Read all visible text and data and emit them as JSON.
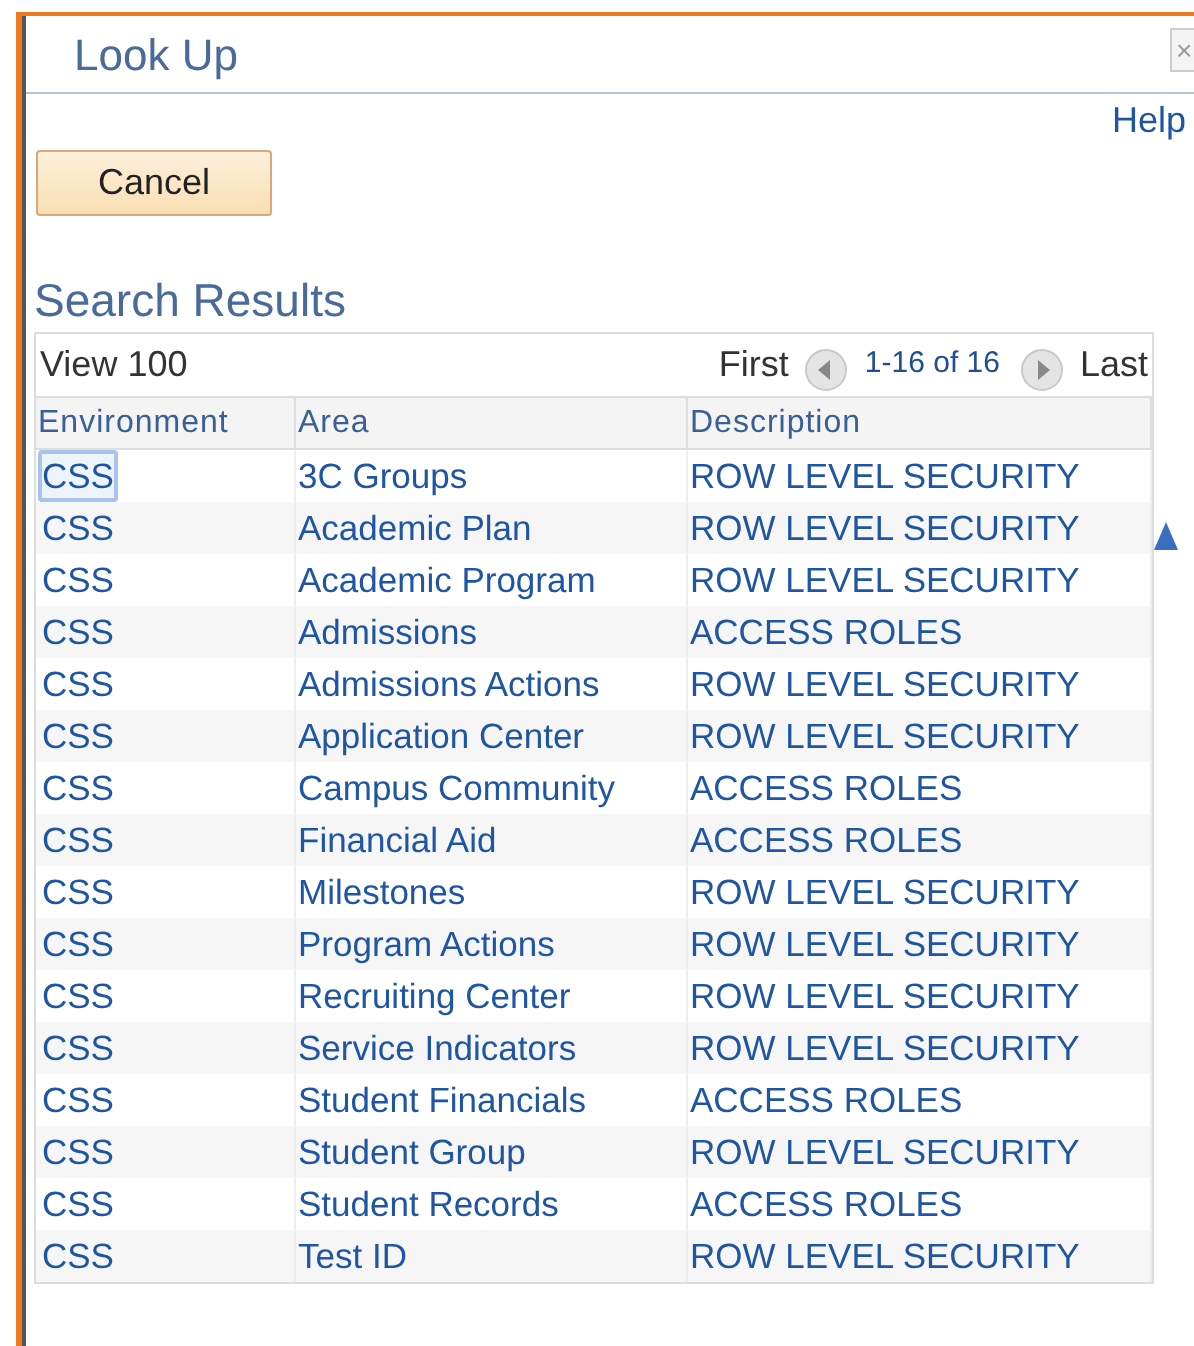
{
  "window": {
    "title": "Look Up",
    "close": "×"
  },
  "help": "Help",
  "cancel_button": "Cancel",
  "section_title": "Search Results",
  "grid": {
    "view_link": "View 100",
    "first": "First",
    "range": "1-16 of 16",
    "last": "Last",
    "columns": [
      "Environment",
      "Area",
      "Description"
    ],
    "rows": [
      {
        "cells": [
          "CSS",
          "3C Groups",
          "ROW LEVEL SECURITY"
        ],
        "focused": true
      },
      {
        "cells": [
          "CSS",
          "Academic Plan",
          "ROW LEVEL SECURITY"
        ],
        "focused": false
      },
      {
        "cells": [
          "CSS",
          "Academic Program",
          "ROW LEVEL SECURITY"
        ],
        "focused": false
      },
      {
        "cells": [
          "CSS",
          "Admissions",
          "ACCESS ROLES"
        ],
        "focused": false
      },
      {
        "cells": [
          "CSS",
          "Admissions Actions",
          "ROW LEVEL SECURITY"
        ],
        "focused": false
      },
      {
        "cells": [
          "CSS",
          "Application Center",
          "ROW LEVEL SECURITY"
        ],
        "focused": false
      },
      {
        "cells": [
          "CSS",
          "Campus Community",
          "ACCESS ROLES"
        ],
        "focused": false
      },
      {
        "cells": [
          "CSS",
          "Financial Aid",
          "ACCESS ROLES"
        ],
        "focused": false
      },
      {
        "cells": [
          "CSS",
          "Milestones",
          "ROW LEVEL SECURITY"
        ],
        "focused": false
      },
      {
        "cells": [
          "CSS",
          "Program Actions",
          "ROW LEVEL SECURITY"
        ],
        "focused": false
      },
      {
        "cells": [
          "CSS",
          "Recruiting Center",
          "ROW LEVEL SECURITY"
        ],
        "focused": false
      },
      {
        "cells": [
          "CSS",
          "Service Indicators",
          "ROW LEVEL SECURITY"
        ],
        "focused": false
      },
      {
        "cells": [
          "CSS",
          "Student Financials",
          "ACCESS ROLES"
        ],
        "focused": false
      },
      {
        "cells": [
          "CSS",
          "Student Group",
          "ROW LEVEL SECURITY"
        ],
        "focused": false
      },
      {
        "cells": [
          "CSS",
          "Student Records",
          "ACCESS ROLES"
        ],
        "focused": false
      },
      {
        "cells": [
          "CSS",
          "Test ID",
          "ROW LEVEL SECURITY"
        ],
        "focused": false
      }
    ]
  }
}
